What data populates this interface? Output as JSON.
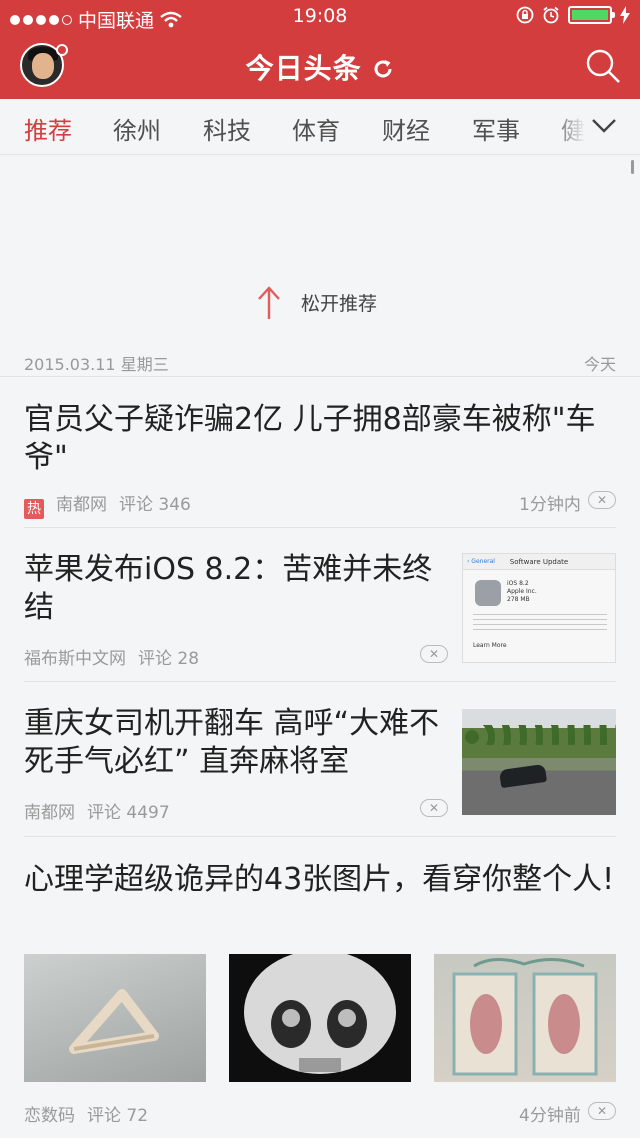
{
  "status_bar": {
    "carrier": "中国联通",
    "time": "19:08"
  },
  "header": {
    "app_title": "今日头条",
    "accent_color": "#d43d3d"
  },
  "tabs": [
    {
      "label": "推荐",
      "active": true
    },
    {
      "label": "徐州",
      "active": false
    },
    {
      "label": "科技",
      "active": false
    },
    {
      "label": "体育",
      "active": false
    },
    {
      "label": "财经",
      "active": false
    },
    {
      "label": "军事",
      "active": false
    },
    {
      "label": "健",
      "active": false
    }
  ],
  "pull_refresh": {
    "text": "松开推荐"
  },
  "date_line": {
    "date": "2015.03.11 星期三",
    "label": "今天"
  },
  "articles": [
    {
      "title": "官员父子疑诈骗2亿 儿子拥8部豪车被称\"车爷\"",
      "hot_badge": "热",
      "source": "南都网",
      "comments": "评论 346",
      "time": "1分钟内",
      "dismiss": "✕"
    },
    {
      "title": "苹果发布iOS 8.2：苦难并未终结",
      "source": "福布斯中文网",
      "comments": "评论 28",
      "dismiss": "✕",
      "thumbnail": {
        "header": "Software Update",
        "back": "‹ General",
        "name": "iOS 8.2",
        "vendor": "Apple Inc.",
        "size": "278 MB",
        "link": "Learn More"
      }
    },
    {
      "title": "重庆女司机开翻车 高呼“大难不死手气必红” 直奔麻将室",
      "source": "南都网",
      "comments": "评论 4497",
      "dismiss": "✕"
    },
    {
      "title": "心理学超级诡异的43张图片，看穿你整个人!",
      "source": "恋数码",
      "comments": "评论 72",
      "time": "4分钟前",
      "dismiss": "✕"
    }
  ]
}
